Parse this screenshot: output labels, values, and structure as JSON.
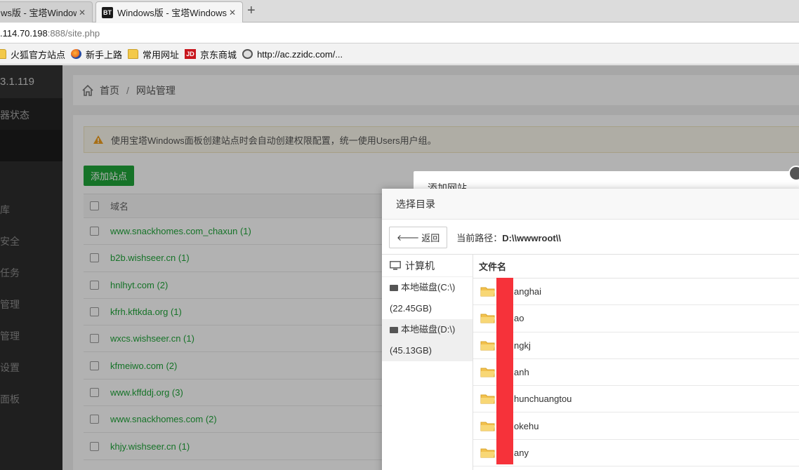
{
  "browser": {
    "tabs": [
      {
        "title": "ws版 - 宝塔Windows",
        "active": false
      },
      {
        "title": "Windows版 - 宝塔Windows",
        "active": true,
        "favicon": "BT"
      }
    ],
    "url_host": ".114.70.198",
    "url_rest": ":888/site.php",
    "bookmarks": [
      {
        "label": "火狐官方站点",
        "icon": "folder-icon"
      },
      {
        "label": "新手上路",
        "icon": "firefox-icon"
      },
      {
        "label": "常用网址",
        "icon": "folder-icon"
      },
      {
        "label": "京东商城",
        "icon": "jd-icon",
        "badge": "JD"
      },
      {
        "label": "http://ac.zzidc.com/...",
        "icon": "globe-icon"
      }
    ]
  },
  "sidebar": {
    "ip": "3.1.119",
    "items": [
      "器状态",
      "",
      "",
      "库",
      "安全",
      "任务",
      "管理",
      "管理",
      "设置",
      "面板"
    ]
  },
  "breadcrumb": {
    "home": "首页",
    "separator": "/",
    "current": "网站管理"
  },
  "alert": {
    "text": "使用宝塔Windows面板创建站点时会自动创建权限配置，统一使用Users用户组。"
  },
  "toolbar": {
    "add_site": "添加站点"
  },
  "site_table": {
    "header": "域名",
    "rows": [
      "www.snackhomes.com_chaxun (1)",
      "b2b.wishseer.cn (1)",
      "hnlhyt.com (2)",
      "kfrh.kftkda.org (1)",
      "wxcs.wishseer.cn (1)",
      "kfmeiwo.com (2)",
      "www.kffddj.org (3)",
      "www.snackhomes.com (2)",
      "khjy.wishseer.cn (1)"
    ]
  },
  "add_site_dialog": {
    "title": "添加网站"
  },
  "dir_dialog": {
    "title": "选择目录",
    "back_label": "返回",
    "path_label": "当前路径：",
    "path_value": "D:\\\\wwwroot\\\\",
    "computer_label": "计算机",
    "disks": [
      {
        "name": "本地磁盘(C:\\)",
        "size": "(22.45GB)",
        "selected": false
      },
      {
        "name": "本地磁盘(D:\\)",
        "size": "(45.13GB)",
        "selected": true
      }
    ],
    "column_header": "文件名",
    "files": [
      "anghai",
      "ao",
      "ngkj",
      "anh",
      "hunchuangtou",
      "okehu",
      "any"
    ]
  }
}
